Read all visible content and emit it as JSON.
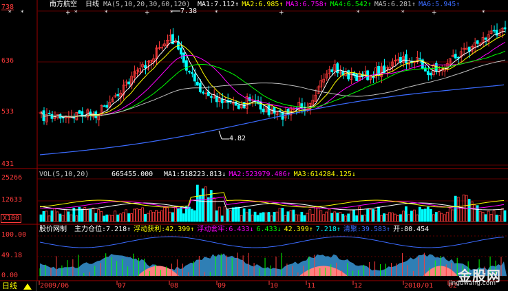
{
  "stock": {
    "name": "南方航空",
    "period": "日线"
  },
  "price_panel": {
    "ma_header": "MA(5,10,20,30,60,120)",
    "ma_values": [
      {
        "label": "MA1:",
        "value": "7.112",
        "arrow": "↑",
        "color": "#ffffff"
      },
      {
        "label": "MA2:",
        "value": "6.985",
        "arrow": "↑",
        "color": "#ffff00"
      },
      {
        "label": "MA3:",
        "value": "6.758",
        "arrow": "↑",
        "color": "#ff00ff"
      },
      {
        "label": "MA4:",
        "value": "6.542",
        "arrow": "↑",
        "color": "#00ff00"
      },
      {
        "label": "MA5:",
        "value": "6.281",
        "arrow": "↑",
        "color": "#c0c0c0"
      },
      {
        "label": "MA6:",
        "value": "5.945",
        "arrow": "↑",
        "color": "#3b6bff"
      }
    ],
    "y_ticks": [
      "738",
      "636",
      "533",
      "431"
    ],
    "annotations": {
      "high": "7.38",
      "low": "4.82"
    }
  },
  "volume_panel": {
    "header": "VOL(5,10,20)",
    "value": "665455.000",
    "ma_values": [
      {
        "label": "MA1:",
        "value": "518223.813",
        "arrow": "↓",
        "color": "#ffffff"
      },
      {
        "label": "MA2:",
        "value": "523979.406",
        "arrow": "↑",
        "color": "#ff00ff"
      },
      {
        "label": "MA3:",
        "value": "614284.125",
        "arrow": "↓",
        "color": "#ffff00"
      }
    ],
    "y_ticks": [
      "25266",
      "12633"
    ],
    "scale_label": "X100"
  },
  "position_panel": {
    "title": "股价网制",
    "items": [
      {
        "label": "主力仓位:",
        "value": "7.218",
        "arrow": "↑",
        "color": "#ffffff"
      },
      {
        "label": "浮动获利:",
        "value": "42.399",
        "arrow": "↑",
        "color": "#ffff00"
      },
      {
        "label": "浮动套牢:",
        "value": "6.433",
        "arrow": "↓",
        "color": "#ff00ff"
      },
      {
        "label": "",
        "value": "6.433",
        "arrow": "↓",
        "color": "#00ff00"
      },
      {
        "label": "",
        "value": "42.399",
        "arrow": "↑",
        "color": "#ffff00"
      },
      {
        "label": "",
        "value": "7.218",
        "arrow": "↑",
        "color": "#00ffff"
      },
      {
        "label": "清聚:",
        "value": "39.583",
        "arrow": "↑",
        "color": "#3b6bff"
      },
      {
        "label": "开:",
        "value": "80.454",
        "arrow": "",
        "color": "#ffffff"
      }
    ],
    "y_ticks": [
      "100.00",
      "49.18",
      "0.00"
    ]
  },
  "x_axis": {
    "labels": [
      "2009/06",
      "07",
      "08",
      "09",
      "10",
      "11",
      "12",
      "2010/01",
      "02"
    ]
  },
  "bottom_tab": {
    "label": "日线"
  },
  "watermark": {
    "big": "金股网",
    "small": "jinguwang.com"
  },
  "colors": {
    "up": "#ff3b3b",
    "down": "#00ffff",
    "grid": "#800000",
    "background": "#000000"
  }
}
